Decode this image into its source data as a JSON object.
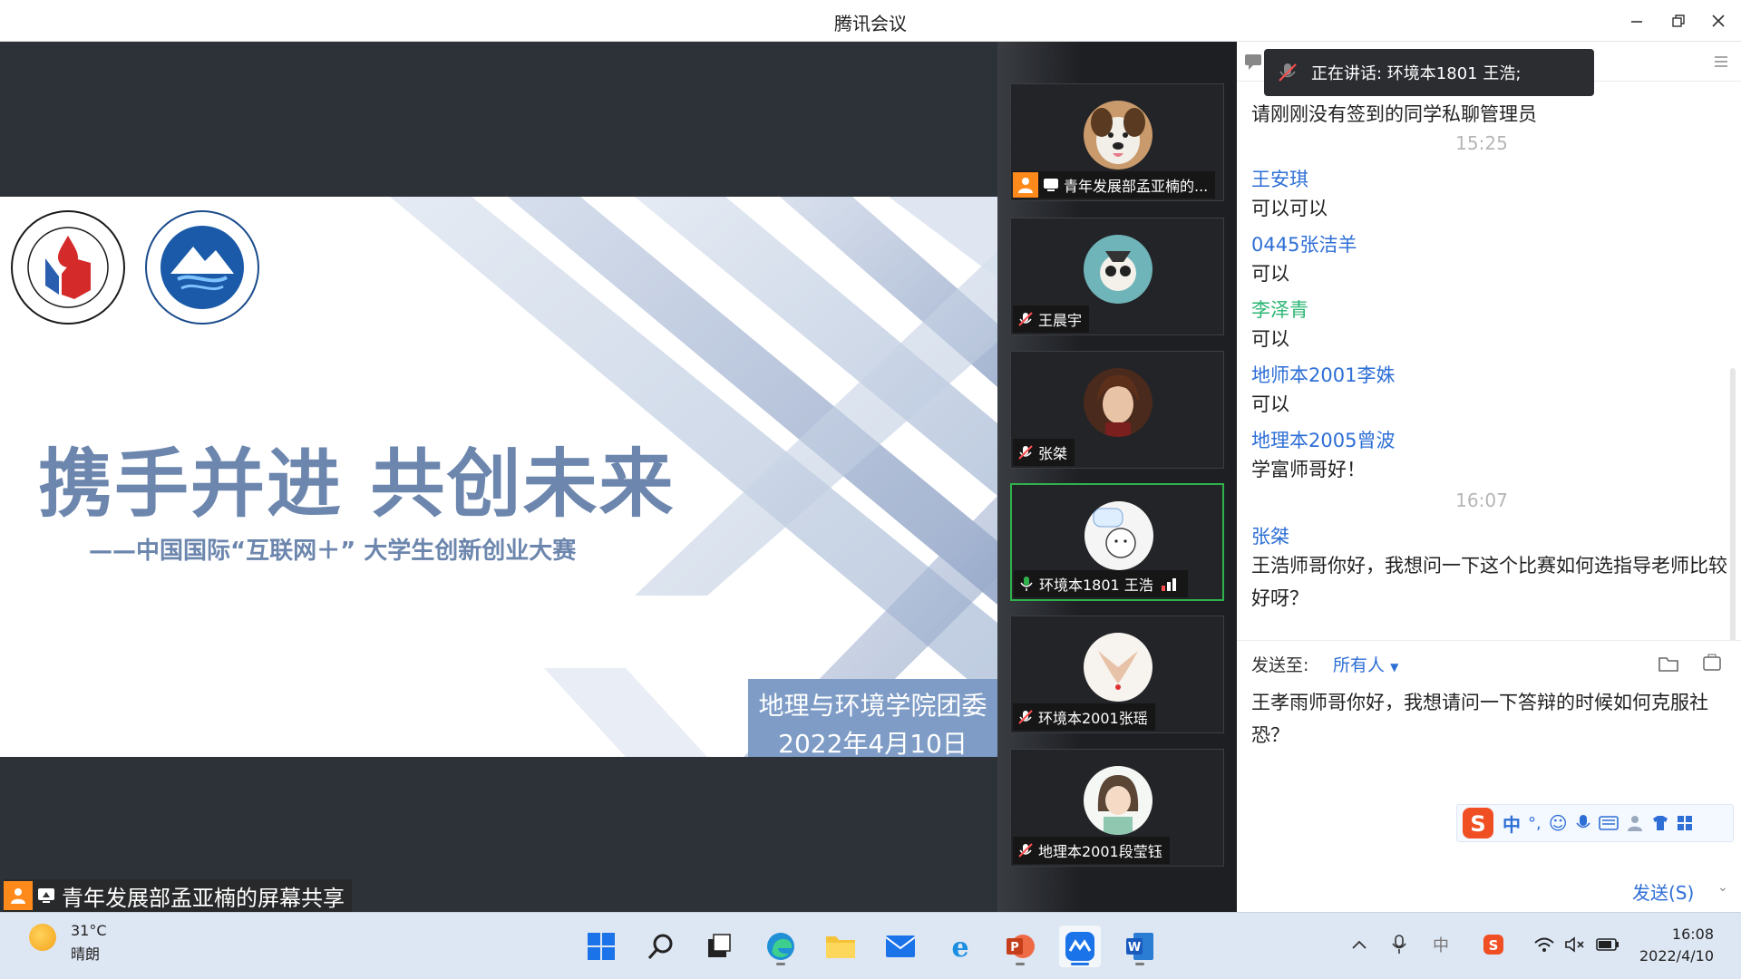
{
  "window": {
    "title": "腾讯会议"
  },
  "share": {
    "slide_title": "携手并进 共创未来",
    "slide_subtitle": "——中国国际“互联网＋” 大学生创新创业大赛",
    "org_line1": "地理与环境学院团委",
    "org_line2": "2022年4月10日",
    "label": "青年发展部孟亚楠的屏幕共享"
  },
  "participants": [
    {
      "name": "青年发展部孟亚楠的...",
      "role": "host-sharing"
    },
    {
      "name": "王晨宇"
    },
    {
      "name": "张桀"
    },
    {
      "name": "环境本1801 王浩",
      "speaking": true
    },
    {
      "name": "环境本2001张瑶"
    },
    {
      "name": "地理本2001段莹钰"
    }
  ],
  "chat": {
    "speaking_banner": "正在讲话: 环境本1801 王浩;",
    "first_text": "请刚刚没有签到的同学私聊管理员",
    "time1": "15:25",
    "messages": [
      {
        "name": "王安琪",
        "text": "可以可以"
      },
      {
        "name": "0445张洁羊",
        "text": "可以"
      },
      {
        "name": "李泽青",
        "text": "可以"
      },
      {
        "name": "地师本2001李姝",
        "text": "可以"
      },
      {
        "name": "地理本2005曾波",
        "text": "学富师哥好！"
      }
    ],
    "time2": "16:07",
    "last": {
      "name": "张桀",
      "text": "王浩师哥你好，我想问一下这个比赛如何选指导老师比较好呀？"
    },
    "send_to_label": "发送至:",
    "recipient": "所有人",
    "draft": "王孝雨师哥你好，我想请问一下答辩的时候如何克服社恐？",
    "ime_label": "中",
    "send_label": "发送(S)"
  },
  "taskbar": {
    "temperature": "31°C",
    "weather": "晴朗",
    "time": "16:08",
    "date": "2022/4/10",
    "ime_indicator": "中"
  },
  "colors": {
    "accent": "#2e6fd6",
    "speaking_green": "#2fb24c",
    "name_green": "#2bb673"
  }
}
